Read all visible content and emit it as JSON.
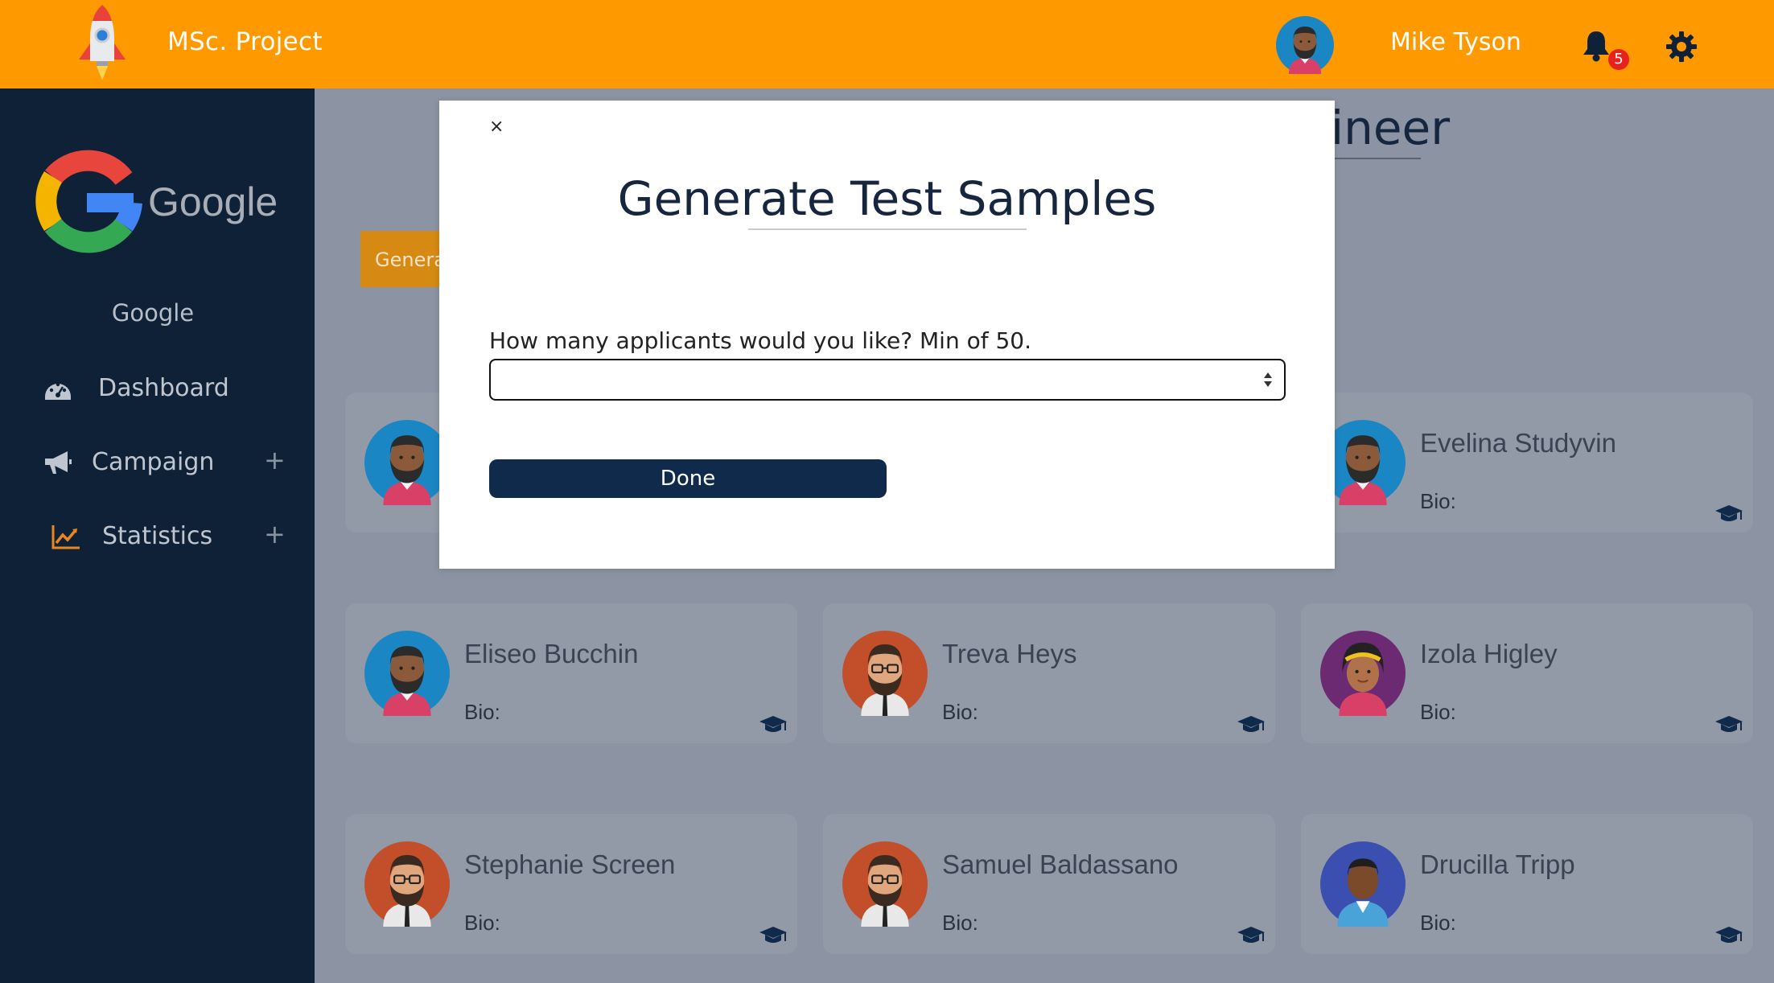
{
  "topbar": {
    "app_title": "MSc. Project",
    "user_name": "Mike Tyson",
    "notification_count": "5",
    "brand_color": "#ff9900"
  },
  "sidebar": {
    "company_name": "Google",
    "company_logo_text": "Google",
    "items": [
      {
        "label": "Dashboard",
        "icon": "dashboard-icon",
        "expandable": false
      },
      {
        "label": "Campaign",
        "icon": "megaphone-icon",
        "expandable": true,
        "expand_symbol": "+"
      },
      {
        "label": "Statistics",
        "icon": "chart-line-icon",
        "expandable": true,
        "expand_symbol": "+"
      }
    ],
    "background_color": "#0f2137"
  },
  "main": {
    "heading_fragment": "ineer",
    "generate_button_label": "Genera",
    "applicants": [
      {
        "name": "Evelina Studyvin",
        "bio_label": "Bio:",
        "avatar": "bearded-man-blue-avatar"
      },
      {
        "name": "Eliseo Bucchin",
        "bio_label": "Bio:",
        "avatar": "bearded-man-blue-avatar"
      },
      {
        "name": "Treva Heys",
        "bio_label": "Bio:",
        "avatar": "bearded-man-glasses-avatar"
      },
      {
        "name": "Izola Higley",
        "bio_label": "Bio:",
        "avatar": "woman-headband-avatar"
      },
      {
        "name": "Stephanie Screen",
        "bio_label": "Bio:",
        "avatar": "bearded-man-glasses-avatar"
      },
      {
        "name": "Samuel Baldassano",
        "bio_label": "Bio:",
        "avatar": "bearded-man-glasses-avatar"
      },
      {
        "name": "Drucilla Tripp",
        "bio_label": "Bio:",
        "avatar": "man-blue-shirt-avatar"
      }
    ]
  },
  "modal": {
    "close_symbol": "×",
    "title": "Generate Test Samples",
    "question": "How many applicants would you like? Min of 50.",
    "input_value": "",
    "input_placeholder": "",
    "done_label": "Done",
    "accent_color": "#0f2a4a"
  }
}
